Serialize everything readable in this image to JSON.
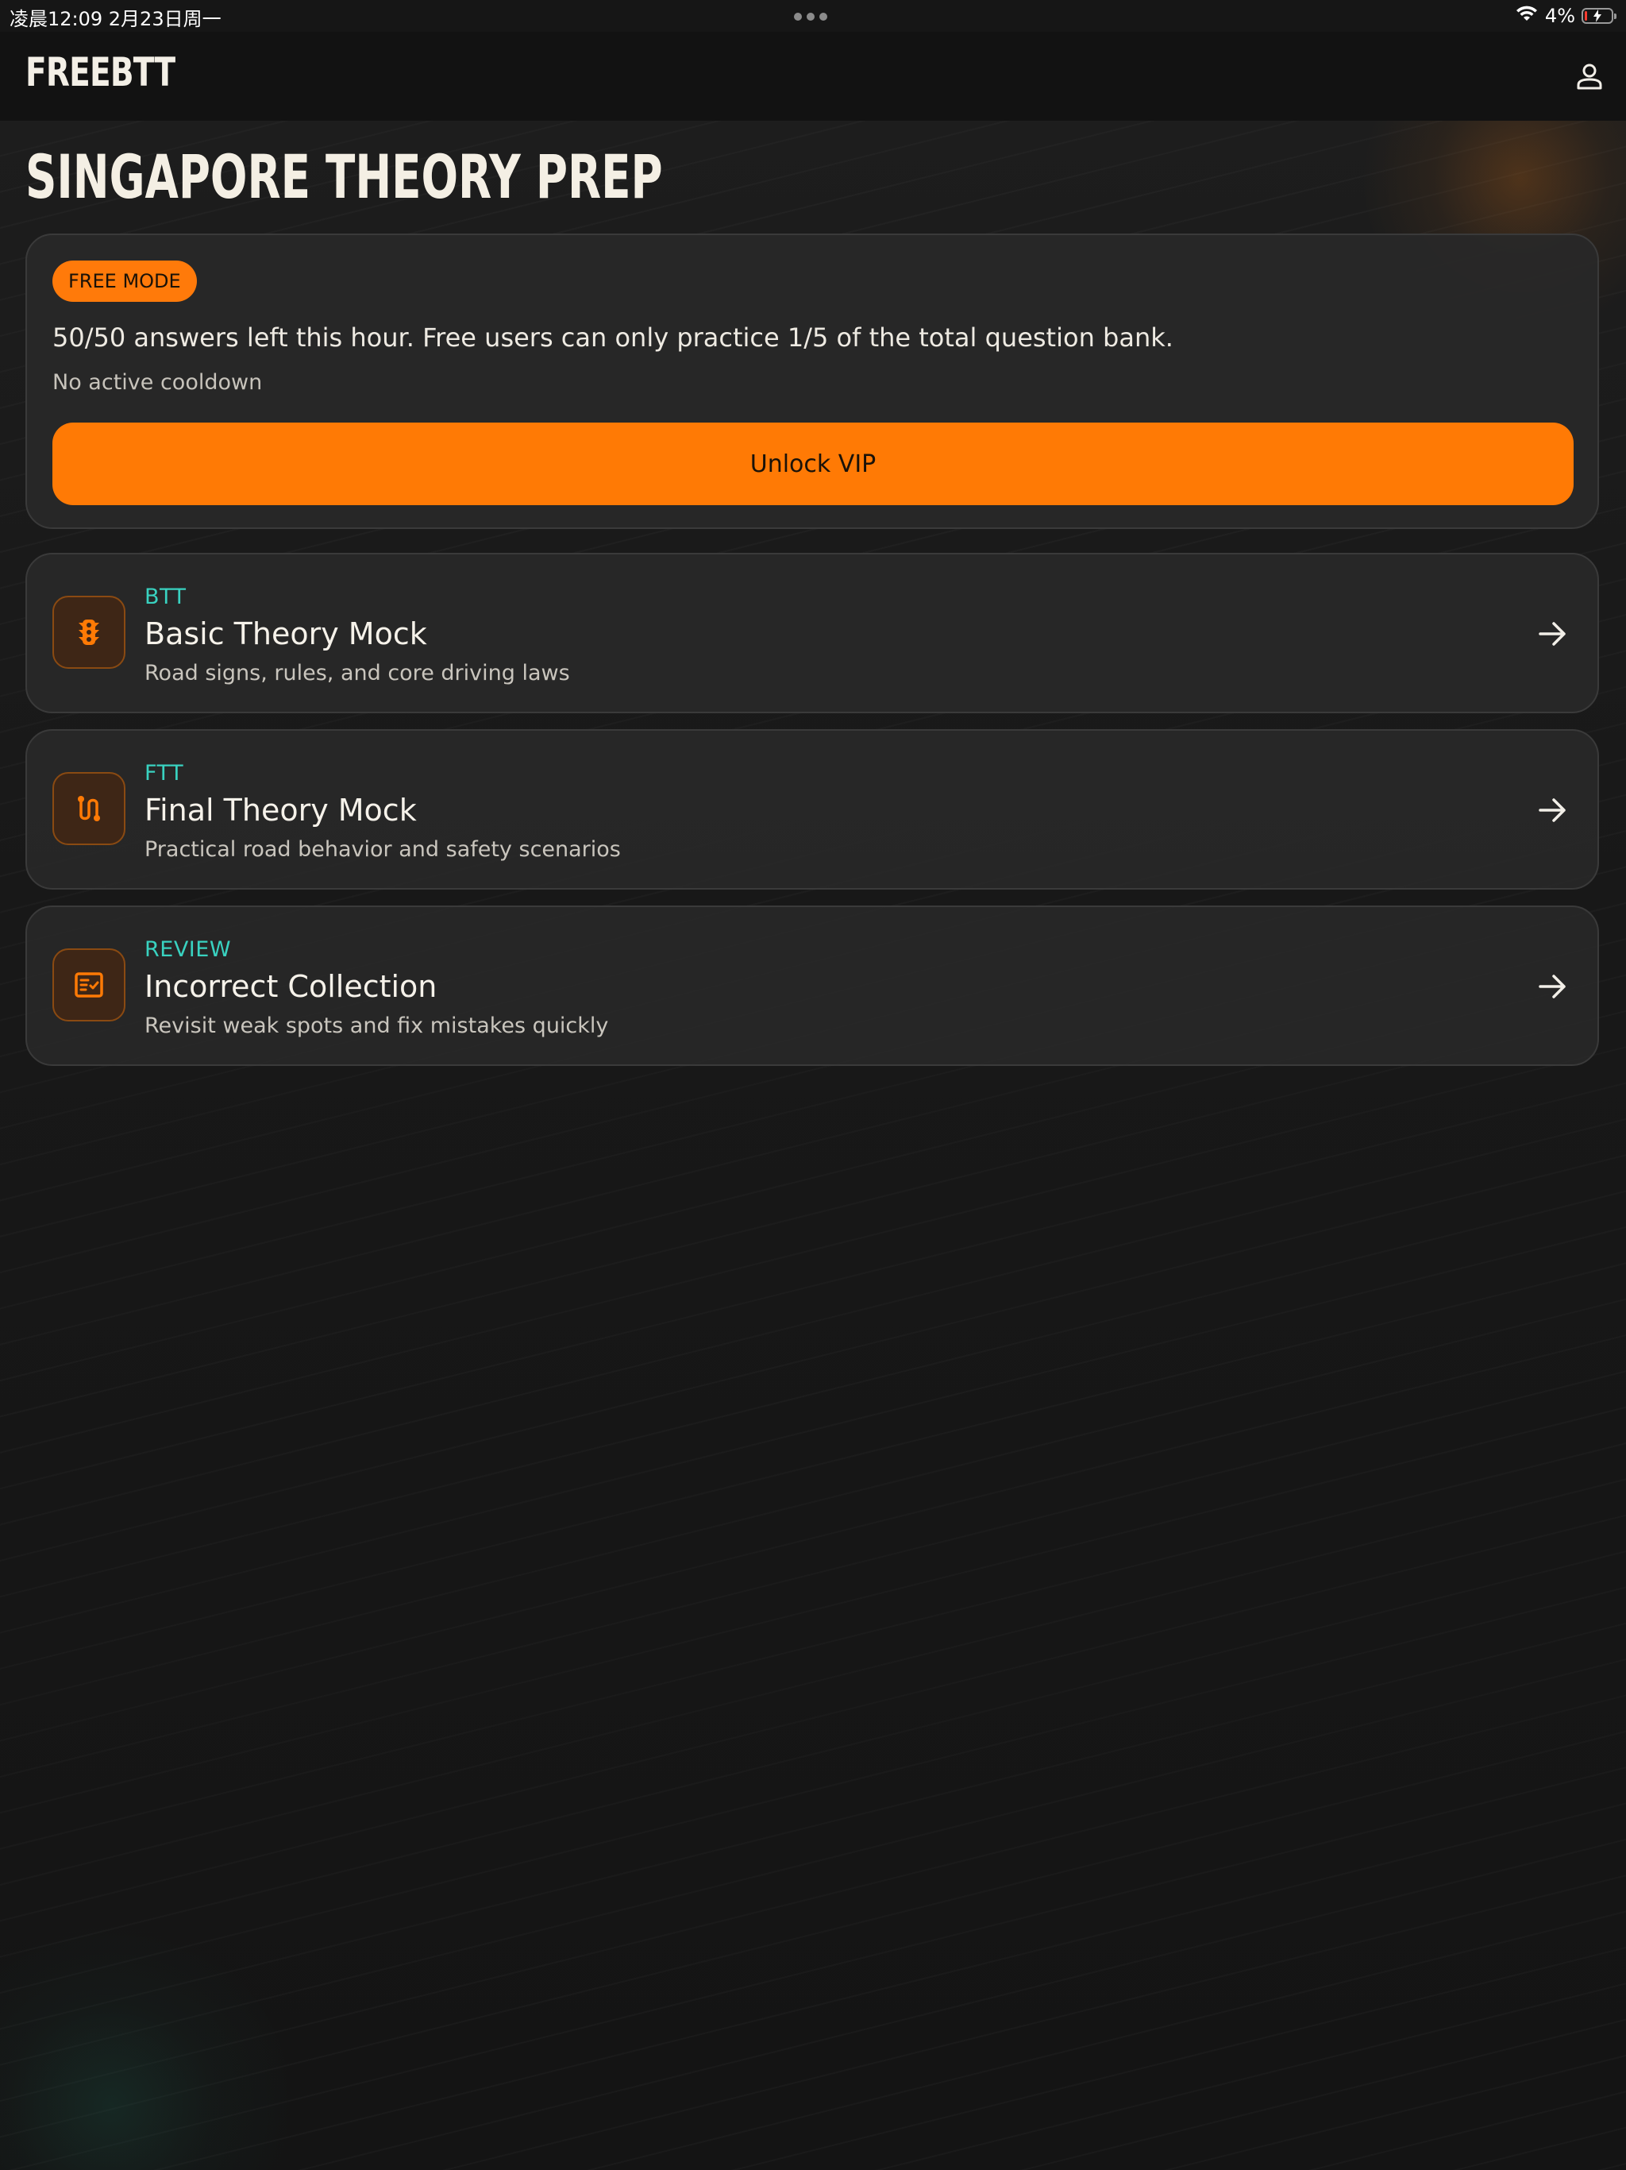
{
  "status_bar": {
    "time": "凌晨12:09   2月23日周一",
    "battery": "4%"
  },
  "app": {
    "brand": "FREEBTT"
  },
  "page": {
    "title": "SINGAPORE THEORY PREP"
  },
  "free_card": {
    "badge": "FREE MODE",
    "message": "50/50 answers left this hour. Free users can only practice 1/5 of the total question bank.",
    "cooldown": "No active cooldown",
    "unlock_label": "Unlock VIP"
  },
  "modes": [
    {
      "tag": "BTT",
      "title": "Basic Theory Mock",
      "description": "Road signs, rules, and core driving laws",
      "icon": "traffic-light-icon"
    },
    {
      "tag": "FTT",
      "title": "Final Theory Mock",
      "description": "Practical road behavior and safety scenarios",
      "icon": "route-icon"
    },
    {
      "tag": "REVIEW",
      "title": "Incorrect Collection",
      "description": "Revisit weak spots and fix mistakes quickly",
      "icon": "checklist-icon"
    }
  ],
  "colors": {
    "accent": "#ff7a05",
    "tag": "#39d2c0",
    "background": "#161616",
    "card": "#282828"
  }
}
